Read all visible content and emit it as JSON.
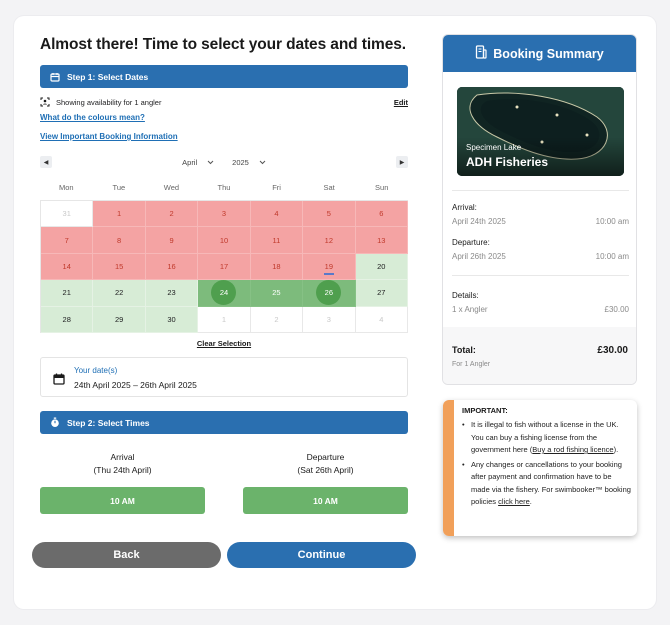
{
  "page": {
    "title": "Almost there! Time to select your dates and times."
  },
  "step1": {
    "label": "Step 1: Select Dates",
    "availability_text": "Showing availability for 1 angler",
    "edit_label": "Edit",
    "colours_link": "What do the colours mean?",
    "info_link": "View Important Booking Information"
  },
  "calendar": {
    "month": "April",
    "year": "2025",
    "prev_label": "◀",
    "next_label": "▶",
    "weekdays": [
      "Mon",
      "Tue",
      "Wed",
      "Thu",
      "Fri",
      "Sat",
      "Sun"
    ],
    "days": [
      {
        "n": "31",
        "s": "muted"
      },
      {
        "n": "1",
        "s": "red"
      },
      {
        "n": "2",
        "s": "red"
      },
      {
        "n": "3",
        "s": "red"
      },
      {
        "n": "4",
        "s": "red"
      },
      {
        "n": "5",
        "s": "red"
      },
      {
        "n": "6",
        "s": "red"
      },
      {
        "n": "7",
        "s": "red"
      },
      {
        "n": "8",
        "s": "red"
      },
      {
        "n": "9",
        "s": "red"
      },
      {
        "n": "10",
        "s": "red"
      },
      {
        "n": "11",
        "s": "red"
      },
      {
        "n": "12",
        "s": "red"
      },
      {
        "n": "13",
        "s": "red"
      },
      {
        "n": "14",
        "s": "red"
      },
      {
        "n": "15",
        "s": "red"
      },
      {
        "n": "16",
        "s": "red"
      },
      {
        "n": "17",
        "s": "red"
      },
      {
        "n": "18",
        "s": "red"
      },
      {
        "n": "19",
        "s": "red",
        "today": true
      },
      {
        "n": "20",
        "s": "green"
      },
      {
        "n": "21",
        "s": "green"
      },
      {
        "n": "22",
        "s": "green"
      },
      {
        "n": "23",
        "s": "green"
      },
      {
        "n": "24",
        "s": "start"
      },
      {
        "n": "25",
        "s": "range"
      },
      {
        "n": "26",
        "s": "end"
      },
      {
        "n": "27",
        "s": "green"
      },
      {
        "n": "28",
        "s": "green"
      },
      {
        "n": "29",
        "s": "green"
      },
      {
        "n": "30",
        "s": "green"
      },
      {
        "n": "1",
        "s": "muted"
      },
      {
        "n": "2",
        "s": "muted"
      },
      {
        "n": "3",
        "s": "muted"
      },
      {
        "n": "4",
        "s": "muted"
      }
    ],
    "clear_label": "Clear Selection"
  },
  "your_dates": {
    "label": "Your date(s)",
    "value": "24th April 2025 – 26th April 2025"
  },
  "step2": {
    "label": "Step 2: Select Times",
    "arrival_title": "Arrival",
    "arrival_date": "(Thu 24th April)",
    "arrival_time": "10 AM",
    "departure_title": "Departure",
    "departure_date": "(Sat 26th April)",
    "departure_time": "10 AM"
  },
  "actions": {
    "back": "Back",
    "continue": "Continue"
  },
  "summary": {
    "title": "Booking Summary",
    "venue_sub": "Specimen Lake",
    "venue_name": "ADH Fisheries",
    "arrival_label": "Arrival:",
    "arrival_date": "April 24th 2025",
    "arrival_time": "10:00 am",
    "departure_label": "Departure:",
    "departure_date": "April 26th 2025",
    "departure_time": "10:00 am",
    "details_label": "Details:",
    "detail_item": "1 x Angler",
    "detail_price": "£30.00",
    "total_label": "Total:",
    "total_value": "£30.00",
    "total_sub": "For 1 Angler"
  },
  "important": {
    "heading": "IMPORTANT:",
    "b1_text": "It is illegal to fish without a license in the UK. You can buy a fishing license from the government here (",
    "b1_link": "Buy a rod fishing licence",
    "b1_end": ").",
    "b2_text": "Any changes or cancellations to your booking after payment and confirmation have to be made via the fishery. For swimbooker™ booking policies ",
    "b2_link": "click here",
    "b2_end": "."
  },
  "colors": {
    "primary": "#2a6fb0",
    "unavailable": "#f4a3a3",
    "available": "#d7ecd6",
    "selected": "#4f9f4e",
    "time_button": "#6bb36b",
    "warning_stripe": "#f1a05a"
  }
}
